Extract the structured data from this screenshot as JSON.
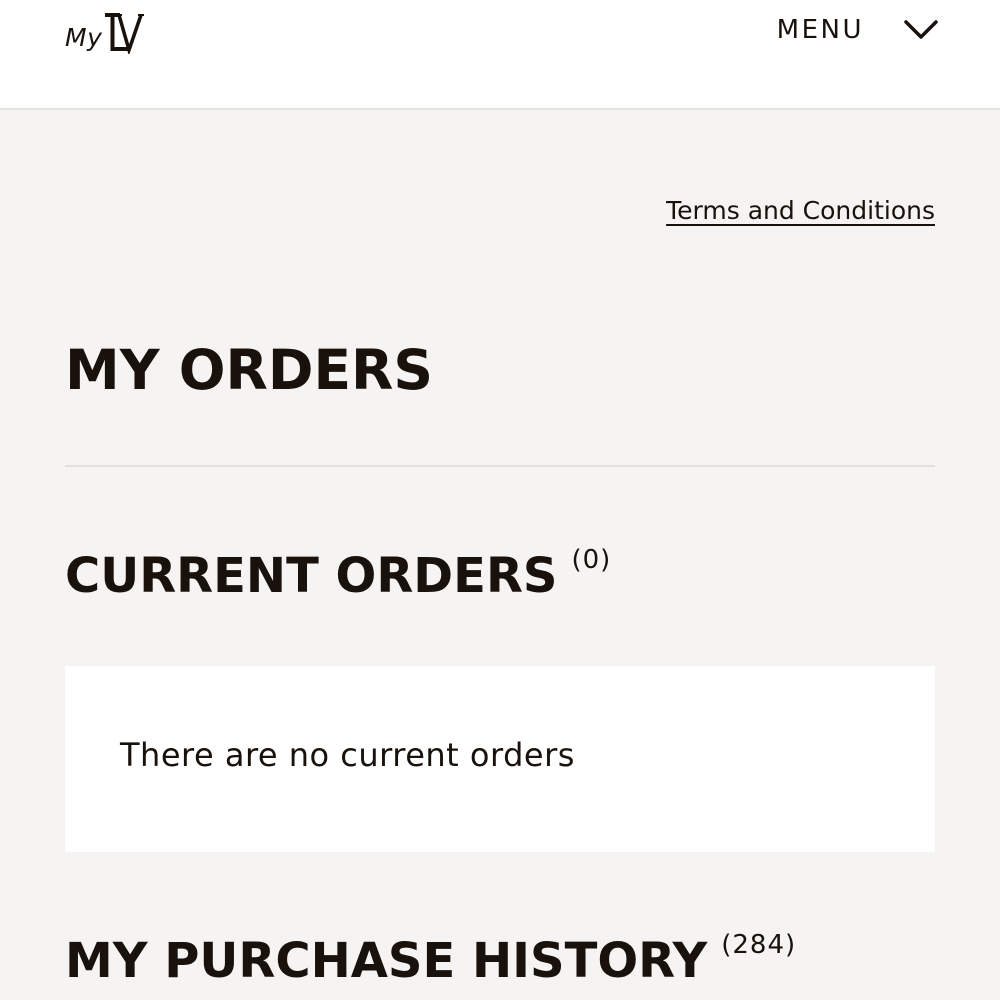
{
  "header": {
    "logo_text": "My",
    "logo_mark": "LV",
    "menu_label": "MENU",
    "menu_icon": "chevron-down-icon"
  },
  "links": {
    "terms": "Terms and Conditions"
  },
  "page": {
    "title": "MY ORDERS"
  },
  "current_orders": {
    "title": "CURRENT ORDERS",
    "count": "(0)",
    "empty_message": "There are no current orders"
  },
  "purchase_history": {
    "title": "MY PURCHASE HISTORY",
    "count": "(284)"
  },
  "colors": {
    "background": "#f5f4f2",
    "header": "#ffffff",
    "text": "#19110b",
    "divider": "#e3e1de"
  }
}
